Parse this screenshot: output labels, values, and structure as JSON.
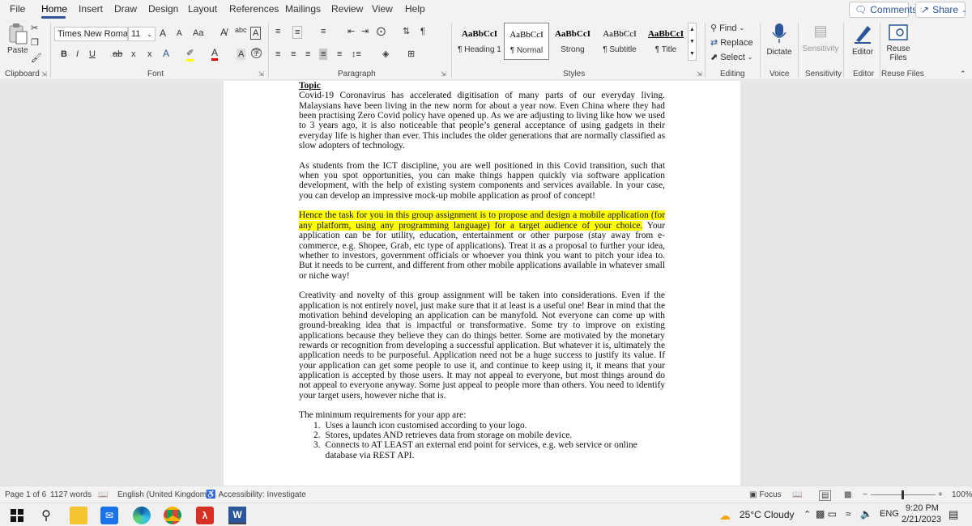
{
  "tabs": [
    "File",
    "Home",
    "Insert",
    "Draw",
    "Design",
    "Layout",
    "References",
    "Mailings",
    "Review",
    "View",
    "Help"
  ],
  "comments_label": "Comments",
  "share_label": "Share",
  "font": {
    "name": "Times New Romar",
    "size": "11",
    "grow": "A",
    "shrink": "A",
    "case": "Aa",
    "bold": "B",
    "italic": "I",
    "underline": "U",
    "strike": "ab",
    "sub": "x",
    "sup": "x"
  },
  "clipboard": {
    "paste_label": "Paste",
    "group_label": "Clipboard"
  },
  "paragraph": {
    "group_label": "Paragraph",
    "pilcrow": "¶"
  },
  "font_group_label": "Font",
  "styles": {
    "group_label": "Styles",
    "items": [
      {
        "sample": "AaBbCcI",
        "name": "¶ Heading 1"
      },
      {
        "sample": "AaBbCcI",
        "name": "¶ Normal"
      },
      {
        "sample": "AaBbCcI",
        "name": "Strong"
      },
      {
        "sample": "AaBbCcI",
        "name": "¶ Subtitle"
      },
      {
        "sample": "AaBbCcI",
        "name": "¶ Title"
      }
    ]
  },
  "editing": {
    "find": "Find",
    "replace": "Replace",
    "select": "Select",
    "group_label": "Editing"
  },
  "voice": {
    "dictate": "Dictate",
    "group_label": "Voice"
  },
  "sensitivity": {
    "label": "Sensitivity",
    "group_label": "Sensitivity"
  },
  "editor": {
    "label": "Editor",
    "group_label": "Editor"
  },
  "reuse": {
    "label1": "Reuse",
    "label2": "Files",
    "group_label": "Reuse Files"
  },
  "document": {
    "topic": "Topic",
    "p1": "Covid-19 Coronavirus has accelerated digitisation of many parts of our everyday living. Malaysians have been living in the new norm for about a year now. Even China where they had been practising Zero Covid policy have opened up. As we are adjusting to living like how we used to 3 years ago, it is also noticeable that people’s general acceptance of using gadgets in their everyday life is higher than ever. This includes the older generations that are normally classified as slow adopters of technology.",
    "p2": "As students from the ICT discipline, you are well positioned in this Covid transition, such that when you spot opportunities, you can make things happen quickly via software application development, with the help of existing system components and services available. In your case, you can develop an impressive mock-up mobile application as proof of concept!",
    "p3_highlight": "Hence the task for you in this group assignment is to propose and design a mobile application (for any platform, using any programming language) for a target audience of your choice.",
    "p3_rest": " Your application can be for utility, education, entertainment or other purpose (stay away from e-commerce, e.g. Shopee, Grab, etc type of applications). Treat it as a proposal to further your idea, whether to investors, government officials or whoever you think you want to pitch your idea to. But it needs to be current, and different from other mobile applications available in whatever small or niche way!",
    "p4": "Creativity and novelty of this group assignment will be taken into considerations. Even if the application is not entirely novel, just make sure that it at least is a useful one! Bear in mind that the motivation behind developing an application can be manyfold. Not everyone can come up with ground-breaking idea that is impactful or transformative. Some try to improve on existing applications because they believe they can do things better. Some are motivated by the monetary rewards or recognition from developing a successful application. But whatever it is, ultimately the application needs to be purposeful. Application need not be a huge success to justify its value. If your application can get some people to use it, and continue to keep using it, it means that your application is accepted by those users. It may not appeal to everyone, but most things around do not appeal to everyone anyway. Some just appeal to people more than others. You need to identify your target users, however niche that is.",
    "req_intro": "The minimum requirements for your app are:",
    "requirements": [
      {
        "num": "1.",
        "text": "Uses a launch icon customised according to your logo."
      },
      {
        "num": "2.",
        "text": "Stores, updates AND retrieves data from storage on mobile device."
      },
      {
        "num": "3.",
        "text": "Connects to AT LEAST an external end point for services, e.g. web service or online database via REST API."
      }
    ]
  },
  "status": {
    "page": "Page 1 of 6",
    "words": "1127 words",
    "language": "English (United Kingdom)",
    "accessibility": "Accessibility: Investigate",
    "focus": "Focus",
    "zoom": "100%"
  },
  "taskbar": {
    "weather": "25°C  Cloudy",
    "lang": "ENG",
    "time": "9:20 PM",
    "date": "2/21/2023"
  },
  "colors": {
    "accent": "#2b579a",
    "highlight": "#ffff00",
    "ribbon_bg": "#f3f2f1"
  }
}
